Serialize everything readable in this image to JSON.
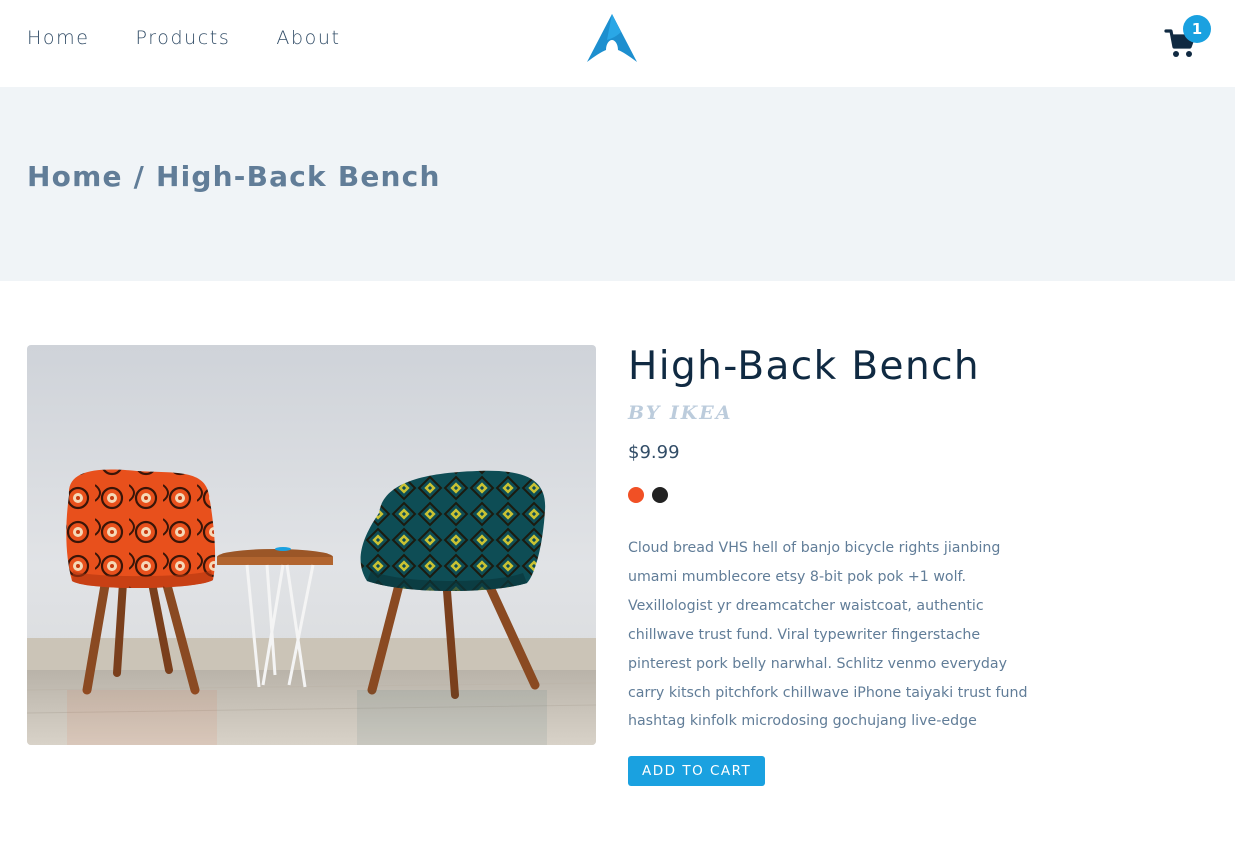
{
  "nav": {
    "links": [
      "Home",
      "Products",
      "About"
    ],
    "cart_count": "1"
  },
  "breadcrumb": {
    "home": "Home",
    "separator": "/",
    "current": "High-Back Bench"
  },
  "product": {
    "title": "High-Back Bench",
    "company": "by ikea",
    "price": "$9.99",
    "colors": [
      "#f15025",
      "#222222"
    ],
    "description": "Cloud bread VHS hell of banjo bicycle rights jianbing umami mumblecore etsy 8-bit pok pok +1 wolf. Vexillologist yr dreamcatcher waistcoat, authentic chillwave trust fund. Viral typewriter fingerstache pinterest pork belly narwhal. Schlitz venmo everyday carry kitsch pitchfork chillwave iPhone taiyaki trust fund hashtag kinfolk microdosing gochujang live-edge",
    "add_to_cart_label": "add to cart",
    "image": "two patterned armchairs with round side table"
  },
  "colors": {
    "accent": "#1aa1e0",
    "heading": "#102a42",
    "muted": "#617d98",
    "hero_bg": "#f0f4f7"
  }
}
